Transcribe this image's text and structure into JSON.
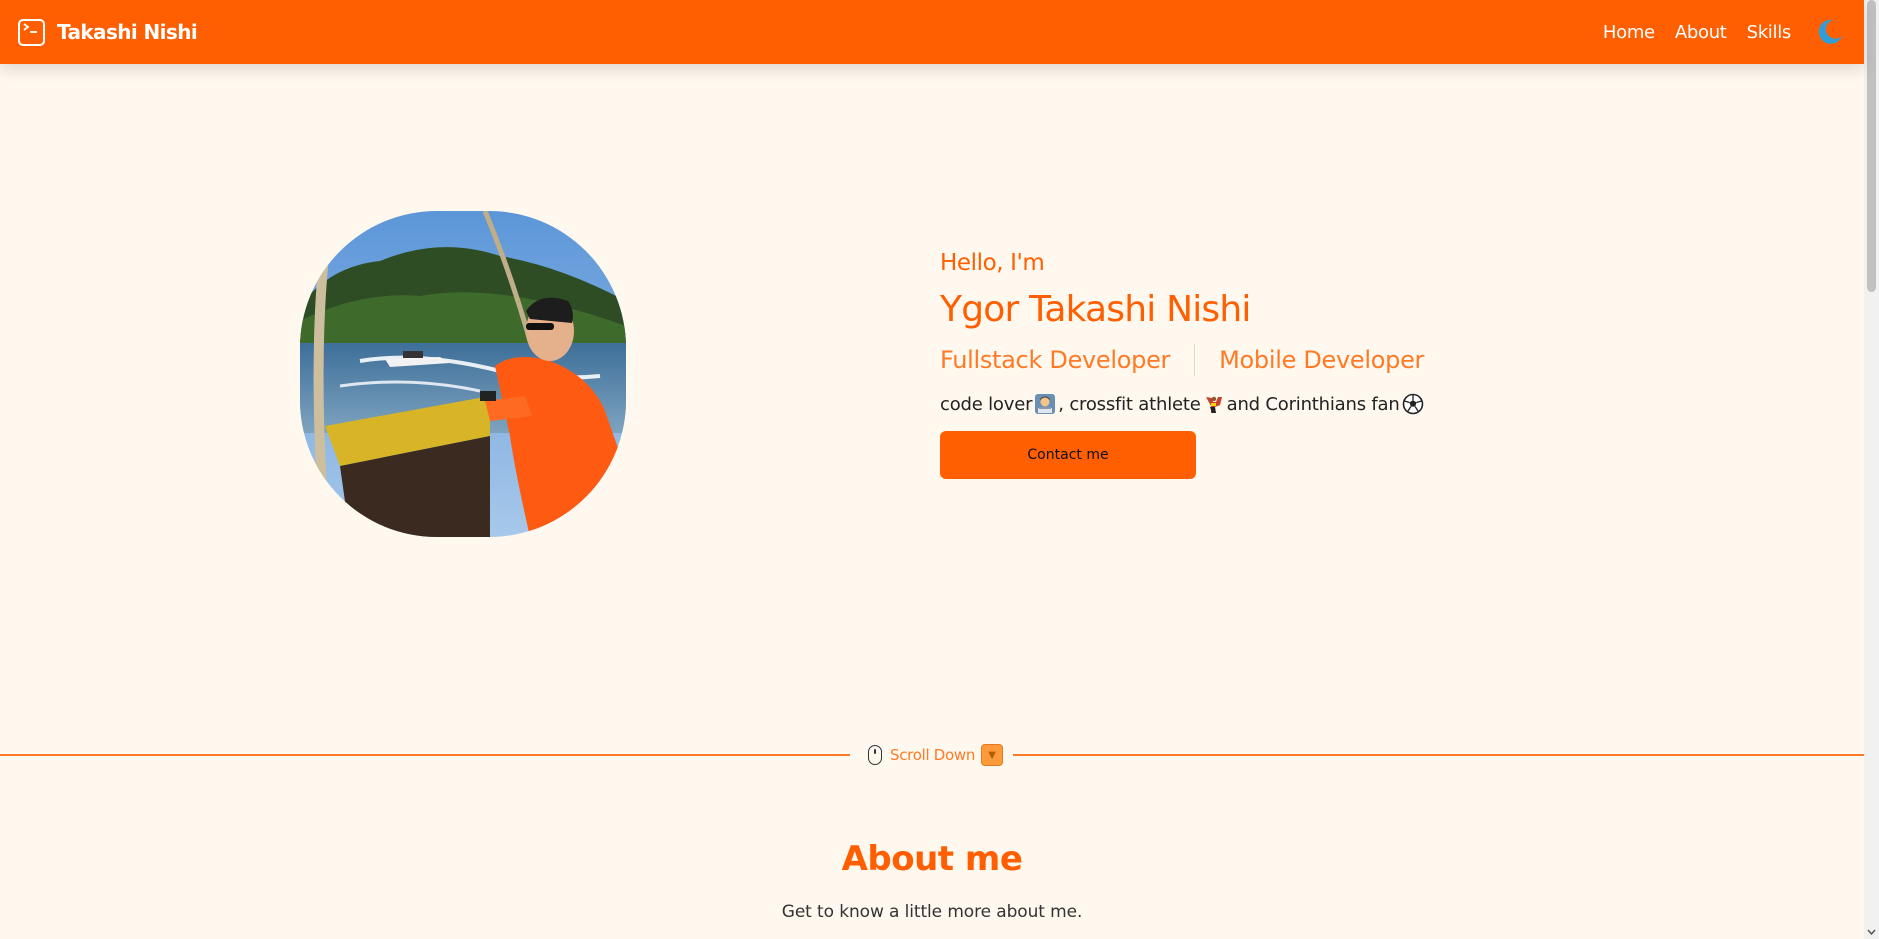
{
  "header": {
    "brand_name": "Takashi Nishi",
    "brand_icon": "terminal-icon",
    "nav": [
      {
        "label": "Home"
      },
      {
        "label": "About"
      },
      {
        "label": "Skills"
      }
    ],
    "theme_icon": "moon-icon"
  },
  "hero": {
    "greeting": "Hello, I'm",
    "name": "Ygor Takashi Nishi",
    "roles": [
      "Fullstack Developer",
      "Mobile Developer"
    ],
    "tagline": {
      "part1": "code lover",
      "part2": ", crossfit athlete",
      "part3": "and Corinthians fan"
    },
    "tagline_icons": [
      "technologist-emoji",
      "flexed-arm-emoji",
      "soccer-ball-emoji"
    ],
    "contact_label": "Contact me"
  },
  "scroll": {
    "label": "Scroll Down",
    "icons": [
      "mouse-icon",
      "arrow-down-icon"
    ]
  },
  "about": {
    "title": "About me",
    "subtitle": "Get to know a little more about me."
  },
  "colors": {
    "accent": "#ff5f00",
    "background": "#fff8ee",
    "moon": "#2f9ed8"
  }
}
